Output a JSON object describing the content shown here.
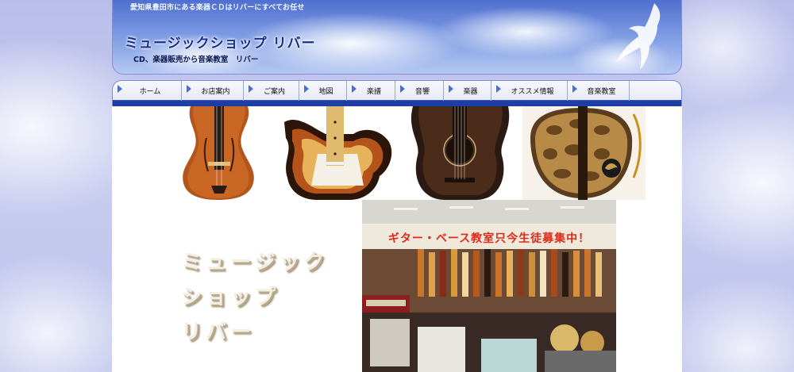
{
  "header": {
    "tagline": "愛知県豊田市にある楽器ＣＤはリバーにすべてお任せ",
    "site_title": "ミュージックショップ リバー",
    "subtitle": "CD、楽器販売から音楽教室　リバー"
  },
  "nav": {
    "items": [
      {
        "label": "ホーム"
      },
      {
        "label": "お店案内"
      },
      {
        "label": "ご案内"
      },
      {
        "label": "地図"
      },
      {
        "label": "楽譜"
      },
      {
        "label": "音響"
      },
      {
        "label": "楽器"
      },
      {
        "label": "オススメ情報"
      },
      {
        "label": "音楽教室"
      }
    ]
  },
  "main": {
    "shop_name_lines": [
      "ミュージック",
      "ショップ",
      "リバー"
    ],
    "store_photo_banner": "ギター・ベース教室只今生徒募集中！"
  },
  "colors": {
    "title_blue": "#1a2f8a",
    "nav_band": "#1d3fa5",
    "banner_red": "#e02a1a"
  }
}
